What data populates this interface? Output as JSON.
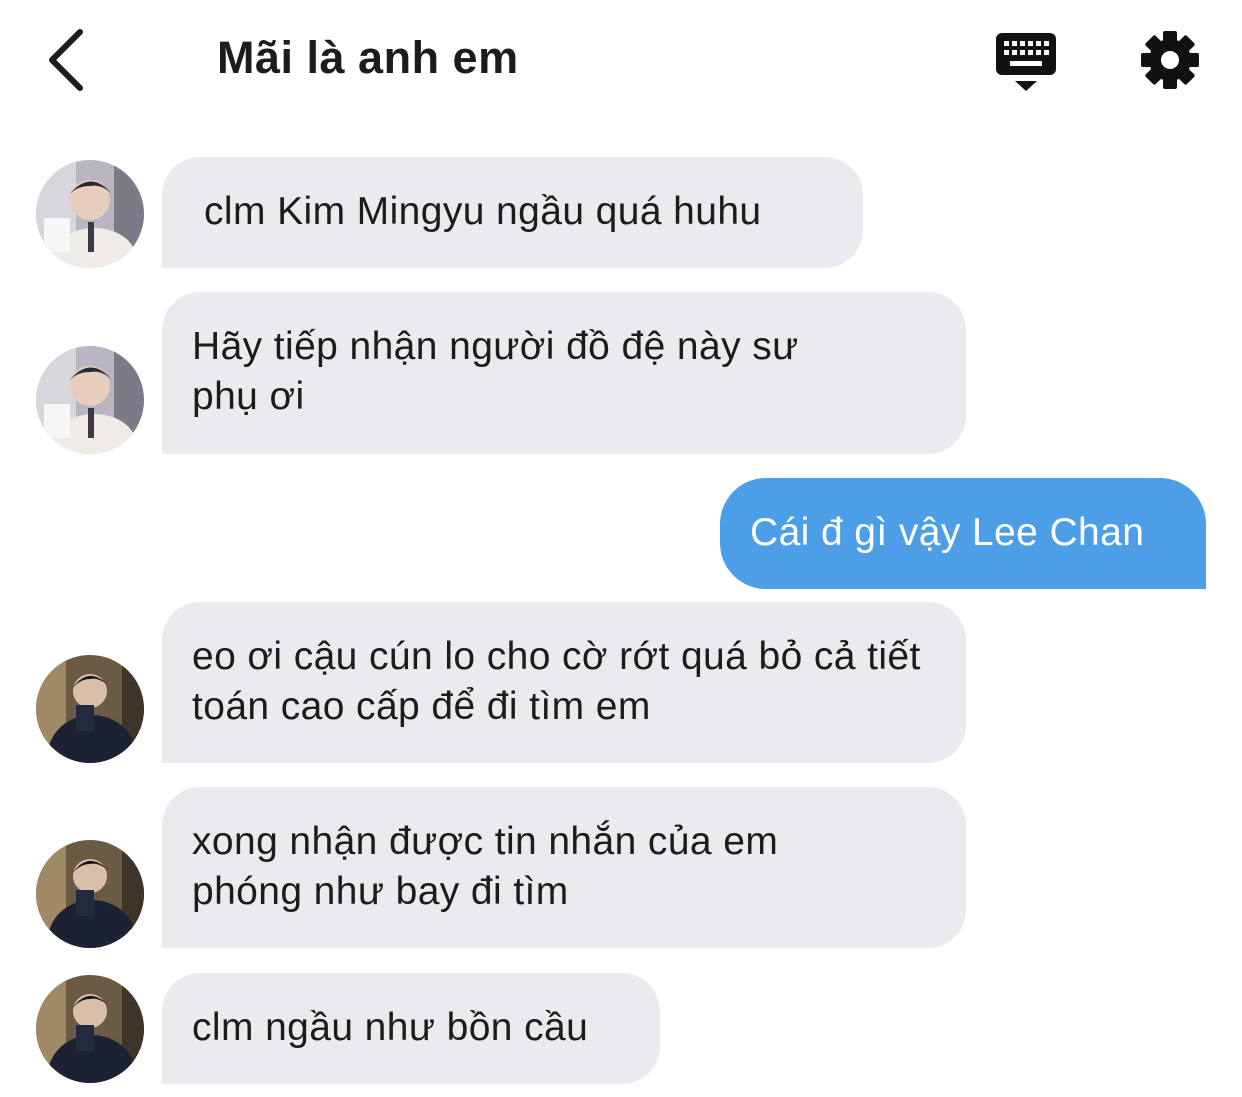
{
  "header": {
    "title": "Mãi là anh em",
    "back_icon": "chevron-left-icon",
    "keyboard_icon": "keyboard-icon",
    "settings_icon": "gear-icon"
  },
  "colors": {
    "incoming_bubble": "#e9ebef",
    "outgoing_bubble": "#4c9fe7",
    "outgoing_text": "#ffffff",
    "text": "#1c1c1e"
  },
  "messages": [
    {
      "direction": "incoming",
      "text": "clm Kim Mingyu ngầu quá huhu",
      "avatar": "avatar-light"
    },
    {
      "direction": "incoming",
      "text": "Hãy tiếp nhận người đồ đệ này sư phụ ơi",
      "avatar": "avatar-light"
    },
    {
      "direction": "outgoing",
      "text": "Cái đ gì vậy Lee Chan"
    },
    {
      "direction": "incoming",
      "text": "eo ơi cậu cún lo cho cờ rớt quá bỏ cả tiết toán cao cấp để đi tìm em",
      "avatar": "avatar-dark"
    },
    {
      "direction": "incoming",
      "text": "xong nhận được tin nhắn của em phóng như bay đi tìm",
      "avatar": "avatar-dark"
    },
    {
      "direction": "incoming",
      "text": "clm ngầu như bồn cầu",
      "avatar": "avatar-dark"
    }
  ]
}
